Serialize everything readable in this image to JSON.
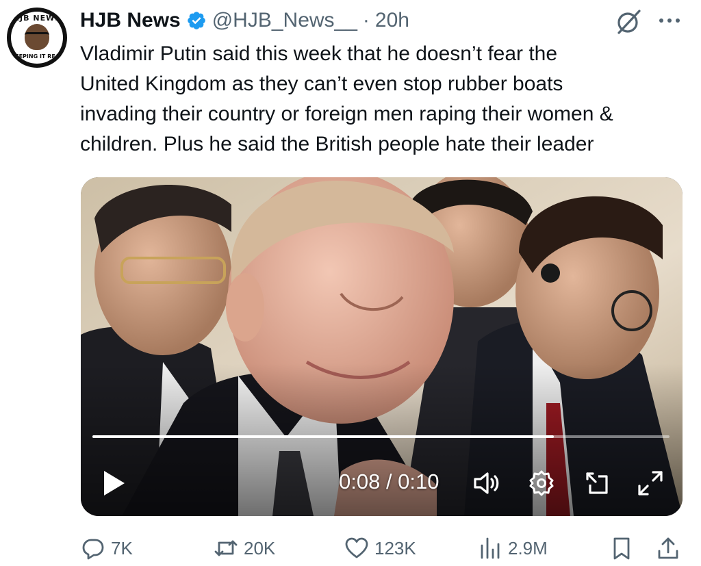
{
  "author": {
    "name": "HJB News",
    "handle": "@HJB_News__",
    "separator": "·",
    "time": "20h",
    "avatar_icon": "hjb-news-logo",
    "avatar_text_top": "HJB NEWS",
    "avatar_text_bottom": "KEEPING IT REAL"
  },
  "tweet": {
    "lines": [
      "Vladimir Putin said this week that he doesn’t fear the",
      "United Kingdom as they can’t even stop rubber boats",
      "invading their country or foreign men raping their women &",
      "children. Plus he said the British people hate their leader"
    ]
  },
  "video": {
    "current_time": "0:08",
    "duration": "0:10",
    "time_display": "0:08 / 0:10",
    "progress_fraction": 0.8
  },
  "actions": {
    "replies": "7K",
    "reposts": "20K",
    "likes": "123K",
    "views": "2.9M"
  },
  "colors": {
    "verified": "#1d9bf0",
    "secondary_text": "#536471",
    "primary_text": "#0f1419"
  }
}
